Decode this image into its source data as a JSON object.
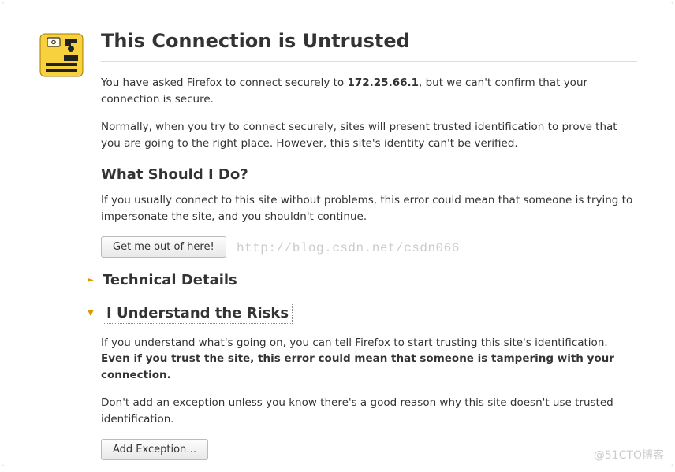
{
  "heading": "This Connection is Untrusted",
  "para1_prefix": "You have asked Firefox to connect securely to ",
  "ip_address": "172.25.66.1",
  "para1_suffix": ", but we can't confirm that your connection is secure.",
  "para2": "Normally, when you try to connect securely, sites will present trusted identification to prove that you are going to the right place. However, this site's identity can't be verified.",
  "subheading1": "What Should I Do?",
  "para3": "If you usually connect to this site without problems, this error could mean that someone is trying to impersonate the site, and you shouldn't continue.",
  "get_out_btn": "Get me out of here!",
  "tech_details_title": "Technical Details",
  "understand_risks_title": "I Understand the Risks",
  "risks_para1_prefix": "If you understand what's going on, you can tell Firefox to start trusting this site's identification. ",
  "risks_para1_bold": "Even if you trust the site, this error could mean that someone is tampering with your connection.",
  "risks_para2": "Don't add an exception unless you know there's a good reason why this site doesn't use trusted identification.",
  "add_exception_btn": "Add Exception…",
  "watermark_url": "http://blog.csdn.net/csdn066",
  "watermark_corner": "@51CTO博客",
  "triangle_closed": "►",
  "triangle_open": "▼"
}
